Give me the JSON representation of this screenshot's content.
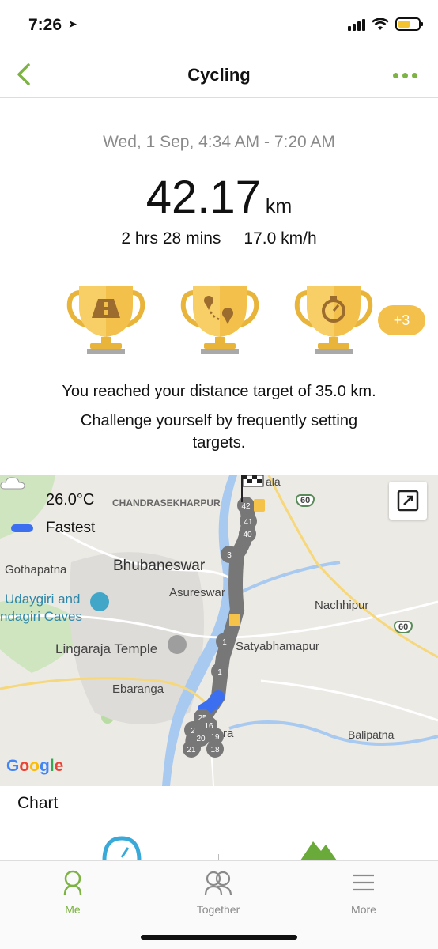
{
  "status": {
    "time": "7:26"
  },
  "nav": {
    "title": "Cycling"
  },
  "summary": {
    "date_range": "Wed, 1 Sep, 4:34 AM - 7:20 AM",
    "distance": "42.17",
    "distance_unit": "km",
    "duration": "2 hrs 28 mins",
    "speed": "17.0 km/h"
  },
  "achievements": {
    "trophies": [
      "road-trophy-icon",
      "route-trophy-icon",
      "stopwatch-trophy-icon"
    ],
    "more_count": "+3",
    "message": "You reached your distance target of 35.0 km.",
    "challenge": "Challenge yourself by frequently setting targets."
  },
  "map": {
    "temperature": "26.0°C",
    "legend_fastest": "Fastest",
    "labels": {
      "chandrasekharpur": "CHANDRASEKHARPUR",
      "bhubaneswar": "Bhubaneswar",
      "gothapatna": "Gothapatna",
      "udaygiri": "Udaygiri and",
      "khandagiri": "ndagiri Caves",
      "asureswar": "Asureswar",
      "lingaraja": "Lingaraja Temple",
      "nachhipur": "Nachhipur",
      "satyabhamapur": "Satyabhamapur",
      "ebaranga": "Ebaranga",
      "balipatna": "Balipatna",
      "hw1": "60",
      "hw2": "60",
      "top_partial": "ala",
      "bottom_partial": "ra"
    },
    "google_letters": [
      "G",
      "o",
      "o",
      "g",
      "l",
      "e"
    ],
    "colors": {
      "route": "#777777",
      "fastest": "#3c6ff0",
      "accent": "#7cb342"
    }
  },
  "chart": {
    "title": "Chart"
  },
  "tabs": [
    {
      "label": "Me",
      "icon": "person-icon",
      "active": true
    },
    {
      "label": "Together",
      "icon": "people-icon",
      "active": false
    },
    {
      "label": "More",
      "icon": "menu-icon",
      "active": false
    }
  ]
}
